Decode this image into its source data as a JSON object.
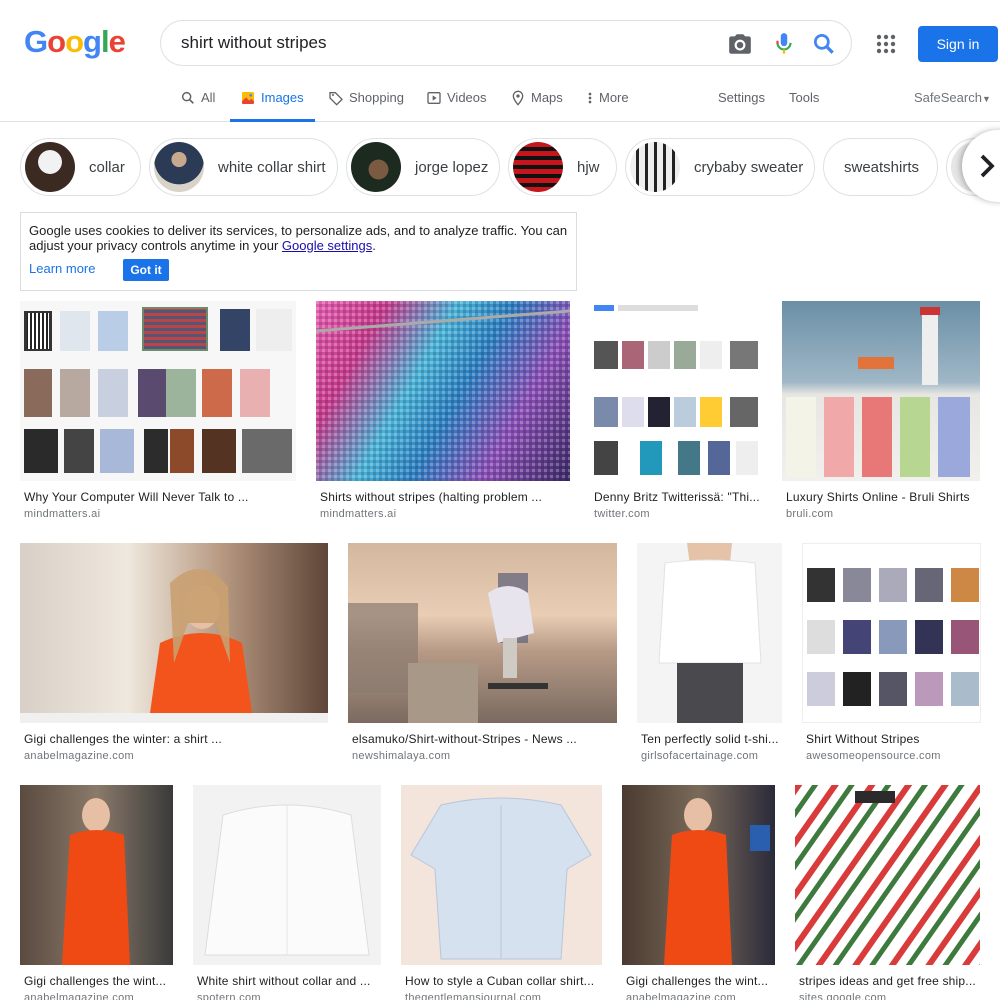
{
  "header": {
    "logo_letters": [
      {
        "ch": "G",
        "color": "#4285f4"
      },
      {
        "ch": "o",
        "color": "#ea4335"
      },
      {
        "ch": "o",
        "color": "#fbbc05"
      },
      {
        "ch": "g",
        "color": "#4285f4"
      },
      {
        "ch": "l",
        "color": "#34a853"
      },
      {
        "ch": "e",
        "color": "#ea4335"
      }
    ],
    "search_query": "shirt without stripes",
    "sign_in": "Sign in"
  },
  "tabs": {
    "all": "All",
    "images": "Images",
    "shopping": "Shopping",
    "videos": "Videos",
    "maps": "Maps",
    "more": "More",
    "settings": "Settings",
    "tools": "Tools",
    "safesearch": "SafeSearch"
  },
  "chips": [
    {
      "label": "collar"
    },
    {
      "label": "white collar shirt"
    },
    {
      "label": "jorge lopez"
    },
    {
      "label": "hjw"
    },
    {
      "label": "crybaby sweater"
    },
    {
      "label": "sweatshirts"
    }
  ],
  "cookie": {
    "text": "Google uses cookies to deliver its services, to personalize ads, and to analyze traffic. You can adjust your privacy controls anytime in your ",
    "link": "Google settings",
    "end": ".",
    "learn_more": "Learn more",
    "got_it": "Got it"
  },
  "results": [
    {
      "caption": "Why Your Computer Will Never Talk to ...",
      "source": "mindmatters.ai"
    },
    {
      "caption": "Shirts without stripes (halting problem ...",
      "source": "mindmatters.ai"
    },
    {
      "caption": "Denny Britz Twitterissä: \"Thi...",
      "source": "twitter.com"
    },
    {
      "caption": "Luxury Shirts Online - Bruli Shirts",
      "source": "bruli.com"
    },
    {
      "caption": "Gigi challenges the winter: a shirt ...",
      "source": "anabelmagazine.com"
    },
    {
      "caption": "elsamuko/Shirt-without-Stripes - News ...",
      "source": "newshimalaya.com"
    },
    {
      "caption": "Ten perfectly solid t-shi...",
      "source": "girlsofacertainage.com"
    },
    {
      "caption": "Shirt Without Stripes",
      "source": "awesomeopensource.com"
    },
    {
      "caption": "Gigi challenges the wint...",
      "source": "anabelmagazine.com"
    },
    {
      "caption": "White shirt without collar and ...",
      "source": "spotern.com"
    },
    {
      "caption": "How to style a Cuban collar shirt...",
      "source": "thegentlemansjournal.com"
    },
    {
      "caption": "Gigi challenges the wint...",
      "source": "anabelmagazine.com"
    },
    {
      "caption": "stripes ideas and get free ship...",
      "source": "sites.google.com"
    }
  ]
}
